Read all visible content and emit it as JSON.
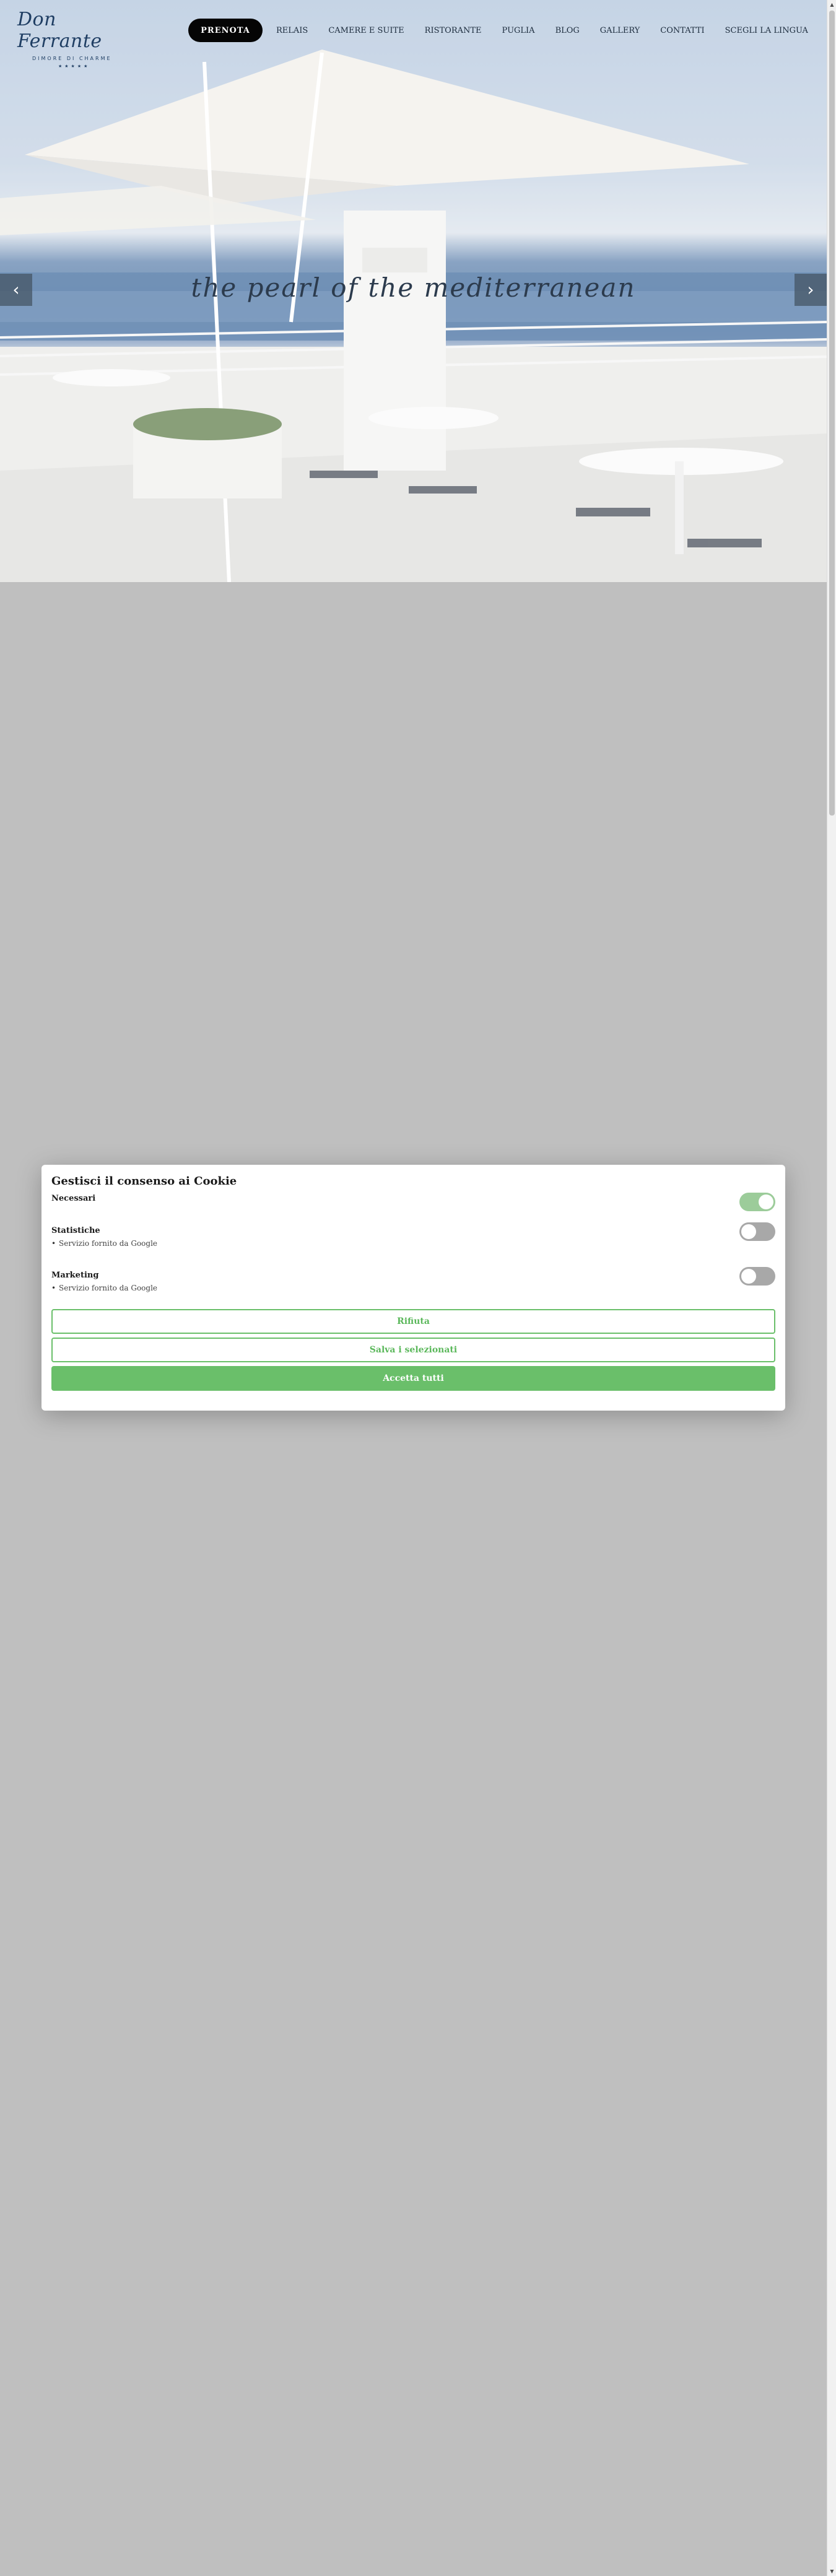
{
  "header": {
    "logo": {
      "name": "Don Ferrante",
      "sub": "DIMORE DI CHARME",
      "stars": "★★★★★"
    },
    "book_label": "PRENOTA",
    "nav": [
      "RELAIS",
      "CAMERE E SUITE",
      "RISTORANTE",
      "PUGLIA",
      "BLOG",
      "GALLERY",
      "CONTATTI",
      "SCEGLI LA LINGUA"
    ]
  },
  "hero": {
    "tagline": "the pearl of the mediterranean",
    "prev_icon": "chevron-left-icon",
    "next_icon": "chevron-right-icon"
  },
  "cookie": {
    "title": "Gestisci il consenso ai Cookie",
    "categories": [
      {
        "title": "Necessari",
        "desc": "",
        "enabled": true
      },
      {
        "title": "Statistiche",
        "desc": "Servizio fornito da Google",
        "enabled": false
      },
      {
        "title": "Marketing",
        "desc": "Servizio fornito da Google",
        "enabled": false
      }
    ],
    "reject_label": "Rifiuta",
    "save_label": "Salva i selezionati",
    "accept_label": "Accetta tutti"
  },
  "colors": {
    "accent": "#6abf6a",
    "toggle_on": "#9ccc9a",
    "toggle_off": "#a8a8a8",
    "book_button": "#050505",
    "overlay": "#bfbfbf"
  }
}
